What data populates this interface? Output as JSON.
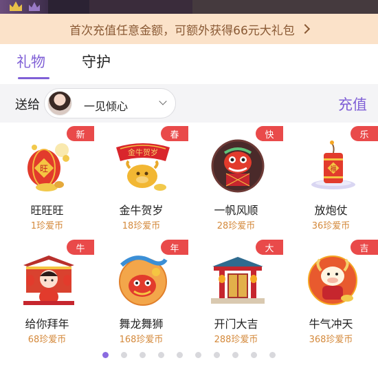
{
  "promo": {
    "text": "首次充值任意金额，可额外获得66元大礼包"
  },
  "tabs": [
    {
      "label": "礼物",
      "active": true
    },
    {
      "label": "守护",
      "active": false
    }
  ],
  "send": {
    "label": "送给",
    "recipient_name": "一见倾心",
    "recharge_label": "充值"
  },
  "gifts": [
    {
      "badge": "新",
      "name": "旺旺旺",
      "price": "1珍爱币"
    },
    {
      "badge": "春",
      "name": "金牛贺岁",
      "price": "18珍爱币"
    },
    {
      "badge": "快",
      "name": "一帆风顺",
      "price": "28珍爱币"
    },
    {
      "badge": "乐",
      "name": "放炮仗",
      "price": "36珍爱币"
    },
    {
      "badge": "牛",
      "name": "给你拜年",
      "price": "68珍爱币"
    },
    {
      "badge": "年",
      "name": "舞龙舞狮",
      "price": "168珍爱币"
    },
    {
      "badge": "大",
      "name": "开门大吉",
      "price": "288珍爱币"
    },
    {
      "badge": "吉",
      "name": "牛气冲天",
      "price": "368珍爱币"
    }
  ],
  "pagination": {
    "pages": 10,
    "current": 1
  },
  "colors": {
    "accent": "#7f5fd6",
    "badge": "#e94a4a",
    "price": "#d4893b",
    "promo_bg": "#fbe2c9"
  }
}
